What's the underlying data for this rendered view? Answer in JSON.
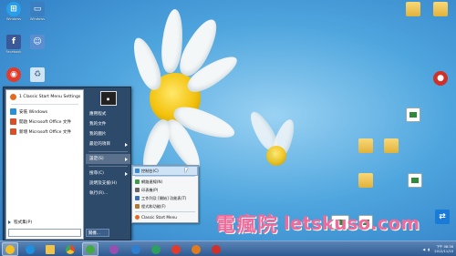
{
  "desktop": {
    "icons_left": [
      {
        "label": "Windows",
        "icon": "windows-icon",
        "color": "#2a9ee8"
      },
      {
        "label": "Windows",
        "icon": "monitor-icon",
        "color": "#3c7fc0"
      },
      {
        "label": "Facebook",
        "icon": "facebook-icon",
        "color": "#3b5998"
      },
      {
        "label": "",
        "icon": "user-icon",
        "color": "#5a8ed0"
      },
      {
        "label": "",
        "icon": "app-icon",
        "color": "#e33b2b"
      },
      {
        "label": "",
        "icon": "recycle-bin-icon",
        "color": "#cfe4f4"
      }
    ],
    "icons_right": [
      {
        "label": "",
        "icon": "folder-icon"
      },
      {
        "label": "",
        "icon": "folder-icon"
      },
      {
        "label": "",
        "icon": "app-icon"
      },
      {
        "label": "",
        "icon": "document-icon"
      },
      {
        "label": "",
        "icon": "folder-icon"
      },
      {
        "label": "",
        "icon": "folder-icon"
      },
      {
        "label": "",
        "icon": "document-icon"
      },
      {
        "label": "",
        "icon": "document-icon"
      }
    ]
  },
  "start_menu": {
    "pinned": [
      {
        "label": "1 Classic Start Menu Settings",
        "icon": "settings-icon",
        "color": "#e46a1f"
      },
      {
        "label": "安裝 Windows",
        "icon": "windows-icon",
        "color": "#2a8ed8"
      },
      {
        "label": "開啟 Microsoft Office 文件",
        "icon": "office-icon",
        "color": "#d8502a"
      },
      {
        "label": "新增 Microsoft Office 文件",
        "icon": "office-icon",
        "color": "#d8502a"
      }
    ],
    "all_programs": "程式集(P)",
    "right_items": [
      {
        "label": "應用程式",
        "sub": false
      },
      {
        "label": "我的文件",
        "sub": false
      },
      {
        "label": "我的圖片",
        "sub": false
      },
      {
        "label": "最近的項目",
        "sub": true
      },
      {
        "label": "設定(S)",
        "sub": true,
        "highlight": true
      },
      {
        "label": "搜尋(C)",
        "sub": true
      },
      {
        "label": "說明及支援(H)",
        "sub": false
      },
      {
        "label": "執行(R)...",
        "sub": false
      }
    ],
    "shutdown": "關機..."
  },
  "settings_submenu": {
    "items": [
      {
        "label": "控制台(C)",
        "icon": "control-panel-icon",
        "color": "#3a8ad0",
        "highlight": true
      },
      {
        "label": "網路連線(N)",
        "icon": "network-icon",
        "color": "#3c9a4a"
      },
      {
        "label": "印表機(P)",
        "icon": "printer-icon",
        "color": "#666666"
      },
      {
        "label": "工作列及 [開始] 功能表(T)",
        "icon": "taskbar-icon",
        "color": "#3a6fb0"
      },
      {
        "label": "程式和功能(F)",
        "icon": "programs-icon",
        "color": "#b07a30"
      },
      {
        "label": "Classic Start Menu",
        "icon": "classic-shell-icon",
        "color": "#e46a1f"
      }
    ]
  },
  "taskbar": {
    "buttons": [
      {
        "icon": "start-icon",
        "color": "#f3c024"
      },
      {
        "icon": "ie-icon",
        "color": "#1f8fe0"
      },
      {
        "icon": "explorer-icon",
        "color": "#f2c34a"
      },
      {
        "icon": "chrome-icon",
        "color": "#e24a33"
      },
      {
        "icon": "app-icon",
        "color": "#45a845"
      },
      {
        "icon": "app-icon",
        "color": "#9a4fb0"
      },
      {
        "icon": "app-icon",
        "color": "#2f7fd0"
      },
      {
        "icon": "app-icon",
        "color": "#2f9f5f"
      },
      {
        "icon": "app-icon",
        "color": "#e33b2b"
      },
      {
        "icon": "app-icon",
        "color": "#e07b20"
      },
      {
        "icon": "app-icon",
        "color": "#d0302a"
      }
    ],
    "time": "下午 08:36",
    "date": "2012/11/10"
  },
  "watermark": {
    "chinese": "電瘋院",
    "english": "letskuso.com",
    "color": "#ef6b99"
  }
}
